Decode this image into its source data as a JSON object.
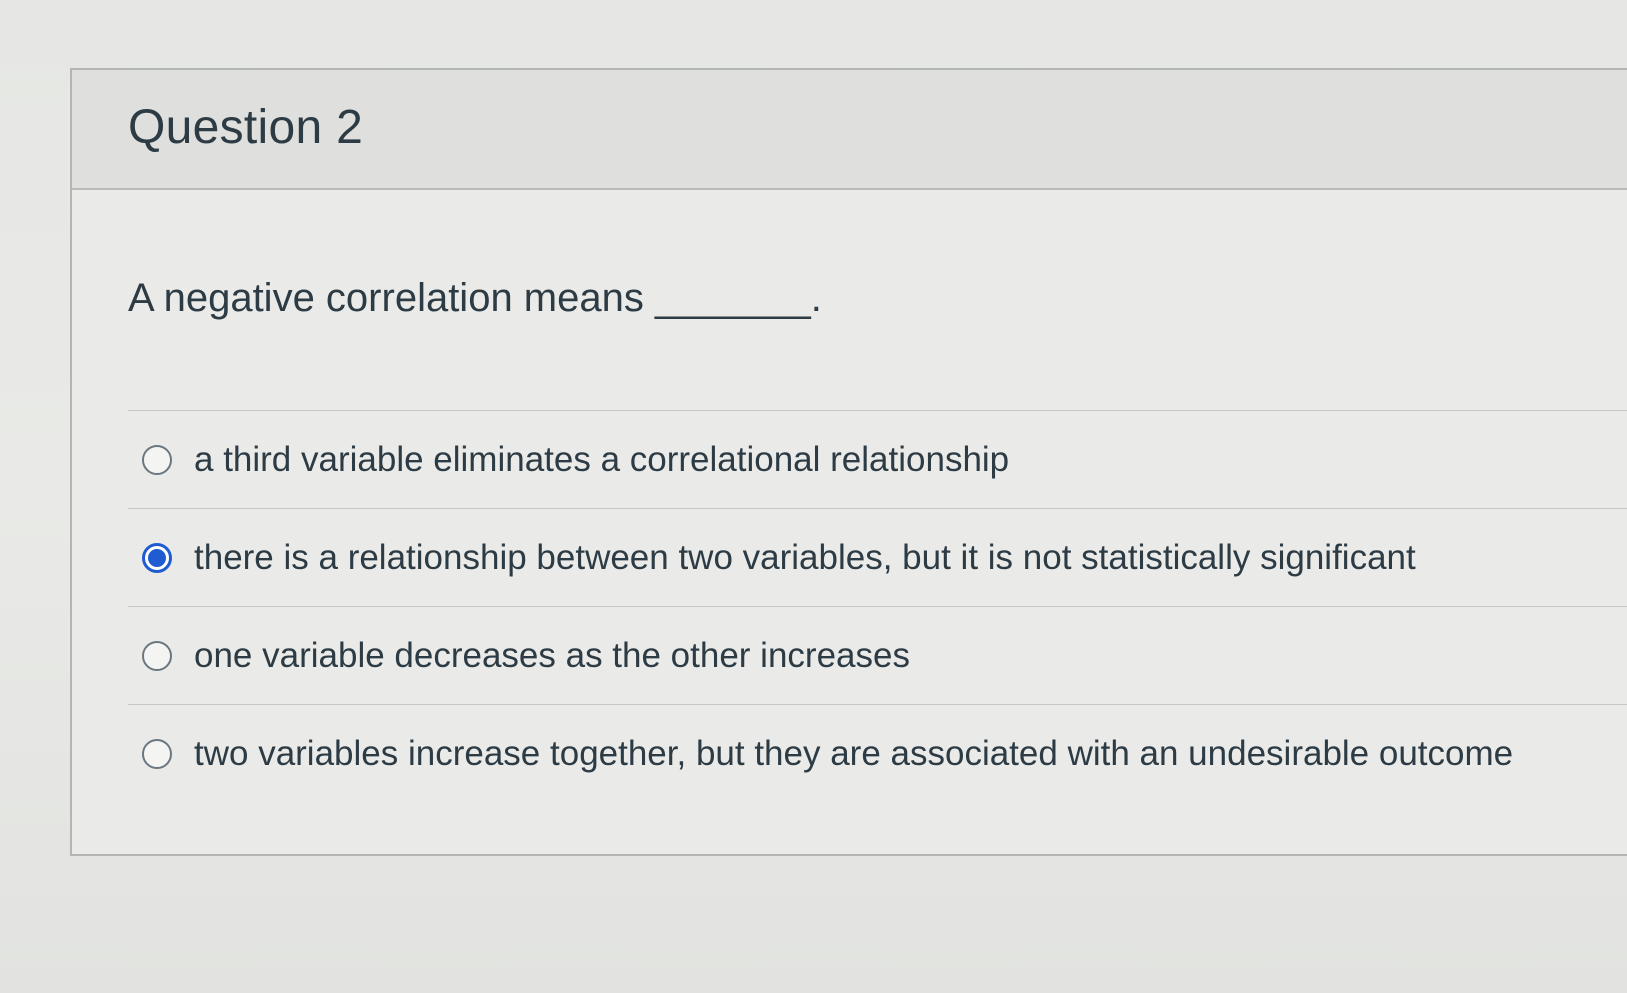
{
  "question": {
    "title": "Question 2",
    "text": "A negative correlation means _______.",
    "answers": [
      {
        "label": "a third variable eliminates a correlational relationship",
        "selected": false
      },
      {
        "label": "there is a relationship between two variables, but it is not statistically significant",
        "selected": true
      },
      {
        "label": "one variable decreases as the other increases",
        "selected": false
      },
      {
        "label": "two variables increase together, but they are associated with an undesirable outcome",
        "selected": false
      }
    ]
  },
  "colors": {
    "accent": "#1f5bd1",
    "text": "#2d3b45"
  }
}
